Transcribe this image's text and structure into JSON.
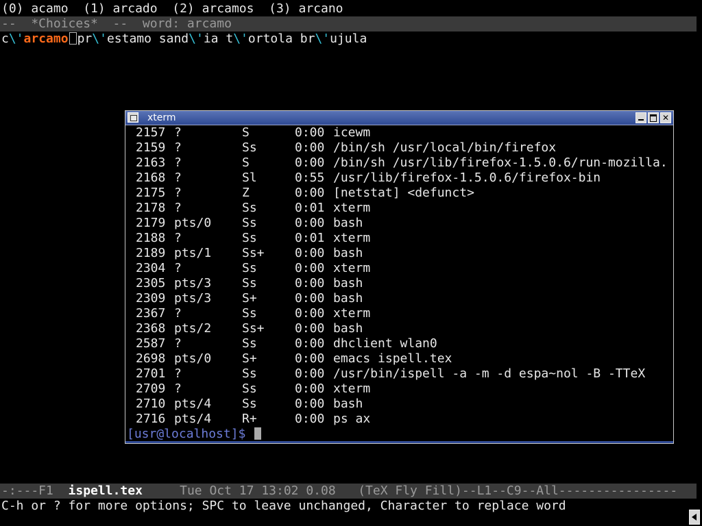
{
  "emacs": {
    "choices_line": "(0) acamo  (1) arcado  (2) arcamos  (3) arcano",
    "choices_modeline": "--  *Choices*  --  word: arcamo",
    "text": {
      "seg1": "c",
      "seg2": "\\'",
      "seg3": "arcamo",
      "seg4": "pr",
      "seg5": "\\'",
      "seg6": "estamo sand",
      "seg7": "\\'",
      "seg8": "ia t",
      "seg9": "\\'",
      "seg10": "ortola br",
      "seg11": "\\'",
      "seg12": "ujula"
    },
    "modeline": {
      "prefix": "-:---F1  ",
      "buffer": "ispell.tex",
      "rest": "     Tue Oct 17 13:02 0.08   (TeX Fly Fill)--L1--C9--All----------------"
    },
    "minibuffer": "C-h or ? for more options; SPC to leave unchanged, Character to replace word"
  },
  "xterm": {
    "title": "xterm",
    "processes": [
      {
        "pid": "2157",
        "tty": "?",
        "stat": "S",
        "time": "0:00",
        "cmd": "icewm"
      },
      {
        "pid": "2159",
        "tty": "?",
        "stat": "Ss",
        "time": "0:00",
        "cmd": "/bin/sh /usr/local/bin/firefox"
      },
      {
        "pid": "2163",
        "tty": "?",
        "stat": "S",
        "time": "0:00",
        "cmd": "/bin/sh /usr/lib/firefox-1.5.0.6/run-mozilla."
      },
      {
        "pid": "2168",
        "tty": "?",
        "stat": "Sl",
        "time": "0:55",
        "cmd": "/usr/lib/firefox-1.5.0.6/firefox-bin"
      },
      {
        "pid": "2175",
        "tty": "?",
        "stat": "Z",
        "time": "0:00",
        "cmd": "[netstat] <defunct>"
      },
      {
        "pid": "2178",
        "tty": "?",
        "stat": "Ss",
        "time": "0:01",
        "cmd": "xterm"
      },
      {
        "pid": "2179",
        "tty": "pts/0",
        "stat": "Ss",
        "time": "0:00",
        "cmd": "bash"
      },
      {
        "pid": "2188",
        "tty": "?",
        "stat": "Ss",
        "time": "0:01",
        "cmd": "xterm"
      },
      {
        "pid": "2189",
        "tty": "pts/1",
        "stat": "Ss+",
        "time": "0:00",
        "cmd": "bash"
      },
      {
        "pid": "2304",
        "tty": "?",
        "stat": "Ss",
        "time": "0:00",
        "cmd": "xterm"
      },
      {
        "pid": "2305",
        "tty": "pts/3",
        "stat": "Ss",
        "time": "0:00",
        "cmd": "bash"
      },
      {
        "pid": "2309",
        "tty": "pts/3",
        "stat": "S+",
        "time": "0:00",
        "cmd": "bash"
      },
      {
        "pid": "2367",
        "tty": "?",
        "stat": "Ss",
        "time": "0:00",
        "cmd": "xterm"
      },
      {
        "pid": "2368",
        "tty": "pts/2",
        "stat": "Ss+",
        "time": "0:00",
        "cmd": "bash"
      },
      {
        "pid": "2587",
        "tty": "?",
        "stat": "Ss",
        "time": "0:00",
        "cmd": "dhclient wlan0"
      },
      {
        "pid": "2698",
        "tty": "pts/0",
        "stat": "S+",
        "time": "0:00",
        "cmd": "emacs ispell.tex"
      },
      {
        "pid": "2701",
        "tty": "?",
        "stat": "Ss",
        "time": "0:00",
        "cmd": "/usr/bin/ispell -a -m -d espa~nol -B -TTeX"
      },
      {
        "pid": "2709",
        "tty": "?",
        "stat": "Ss",
        "time": "0:00",
        "cmd": "xterm"
      },
      {
        "pid": "2710",
        "tty": "pts/4",
        "stat": "Ss",
        "time": "0:00",
        "cmd": "bash"
      },
      {
        "pid": "2716",
        "tty": "pts/4",
        "stat": "R+",
        "time": "0:00",
        "cmd": "ps ax"
      }
    ],
    "prompt": "[usr@localhost]$ "
  },
  "icons": {
    "window_menu": "window-menu-icon",
    "minimize": "minimize-icon",
    "maximize": "maximize-icon",
    "close": "close-icon",
    "scroll": "left-arrow-icon"
  },
  "colors": {
    "accent_cyan": "#36c0d6",
    "current_word_orange": "#ff6a1a",
    "titlebar_blue": "#2f4a94",
    "prompt_blue": "#6c7cd8",
    "modeline_gray": "#3a3a3a"
  }
}
